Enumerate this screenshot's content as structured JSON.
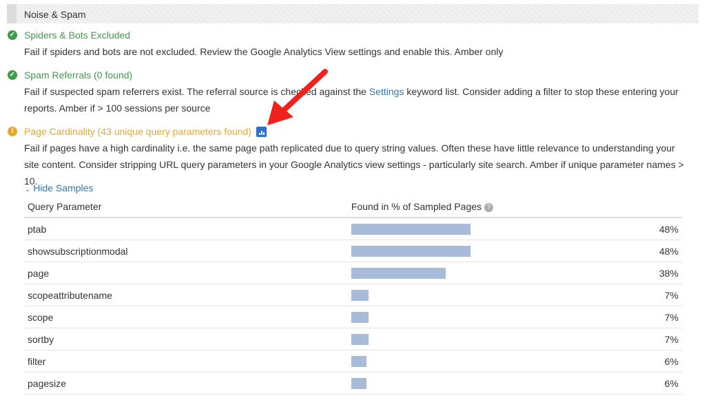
{
  "section": {
    "title": "Noise & Spam"
  },
  "items": [
    {
      "status": "ok",
      "title": "Spiders & Bots Excluded",
      "desc": "Fail if spiders and bots are not excluded. Review the Google Analytics View settings and enable this. Amber only"
    },
    {
      "status": "ok",
      "title": "Spam Referrals (0 found)",
      "desc_part1": "Fail if suspected spam referrers exist. The referral source is checked against the ",
      "desc_link": "Settings",
      "desc_part2": " keyword list. Consider adding a filter to stop these entering your reports. Amber if > 100 sessions per source"
    },
    {
      "status": "warn",
      "title": "Page Cardinality (43 unique query parameters found)",
      "desc": "Fail if pages have a high cardinality i.e. the same page path replicated due to query string values. Often these have little relevance to understanding your site content. Consider stripping URL query parameters in your Google Analytics view settings - particularly site search. Amber if unique parameter names > 10."
    }
  ],
  "samples": {
    "toggle_label": "Hide Samples",
    "col_param": "Query Parameter",
    "col_found": "Found in % of Sampled Pages",
    "bar_color": "#a8bbd8",
    "rows": [
      {
        "param": "ptab",
        "pct_label": "48%",
        "value": 48
      },
      {
        "param": "showsubscriptionmodal",
        "pct_label": "48%",
        "value": 48
      },
      {
        "param": "page",
        "pct_label": "38%",
        "value": 38
      },
      {
        "param": "scopeattributename",
        "pct_label": "7%",
        "value": 7
      },
      {
        "param": "scope",
        "pct_label": "7%",
        "value": 7
      },
      {
        "param": "sortby",
        "pct_label": "7%",
        "value": 7
      },
      {
        "param": "filter",
        "pct_label": "6%",
        "value": 6
      },
      {
        "param": "pagesize",
        "pct_label": "6%",
        "value": 6
      }
    ]
  },
  "colors": {
    "ok": "#3e9d4a",
    "warn": "#e6a92b",
    "link": "#2e79b5",
    "annotation_arrow": "#f0221b"
  },
  "icons": [
    "check-circle-icon",
    "warning-circle-icon",
    "chart-icon",
    "help-icon",
    "chevron-down-icon"
  ]
}
